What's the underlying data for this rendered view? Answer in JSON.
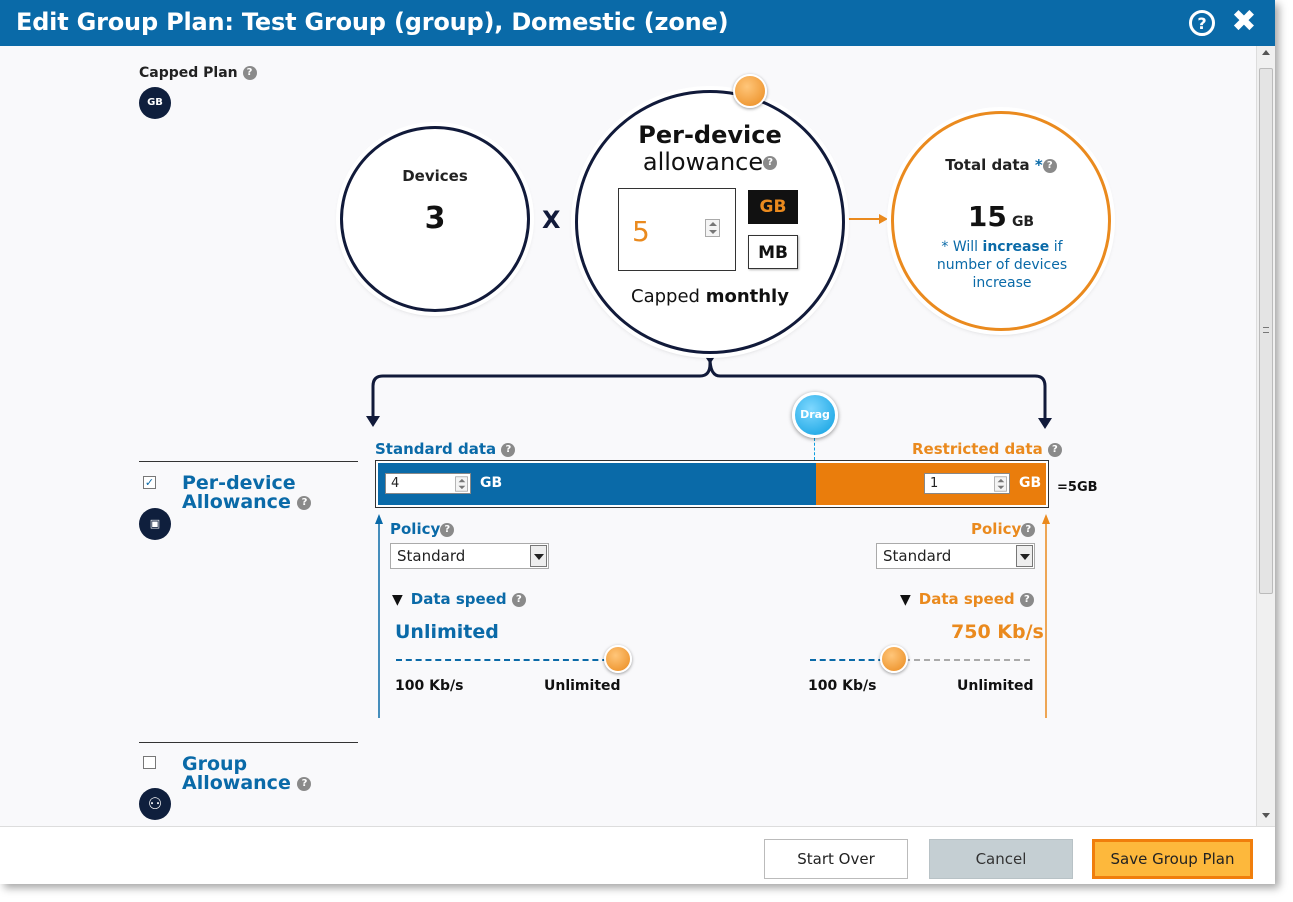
{
  "dialog": {
    "title": "Edit Group Plan: Test Group (group), Domestic (zone)",
    "help_icon": "?",
    "close_icon": "✖"
  },
  "plan_type": {
    "label": "Capped Plan",
    "icon_text": "GB"
  },
  "devices": {
    "label": "Devices",
    "value": "3",
    "operator": "X"
  },
  "allowance": {
    "title_bold": "Per-device",
    "title_light": "allowance",
    "value": "5",
    "unit_gb": "GB",
    "unit_mb": "MB",
    "selected_unit": "GB",
    "footer_prefix": "Capped ",
    "footer_bold": "monthly"
  },
  "total": {
    "label": "Total data",
    "asterisk": "*",
    "value": "15",
    "unit": "GB",
    "note_prefix": "* Will ",
    "note_bold": "increase",
    "note_suffix": " if number of devices increase"
  },
  "split": {
    "standard_label": "Standard data",
    "restricted_label": "Restricted data",
    "drag_label": "Drag",
    "standard_value": "4",
    "restricted_value": "1",
    "unit": "GB",
    "total_label": "=5GB",
    "standard_fraction": 0.8
  },
  "sections": {
    "per_device": {
      "title_line1": "Per-device",
      "title_line2": "Allowance",
      "checked": true,
      "check_mark": "✓",
      "icon_text": "▣"
    },
    "group": {
      "title_line1": "Group",
      "title_line2": "Allowance",
      "checked": false,
      "icon_text": "⚇"
    }
  },
  "policy": {
    "label": "Policy",
    "standard_selected": "Standard",
    "restricted_selected": "Standard"
  },
  "data_speed": {
    "label": "Data speed",
    "collapse_icon": "▼",
    "standard_value": "Unlimited",
    "restricted_value": "750 Kb/s",
    "min_label": "100 Kb/s",
    "max_label": "Unlimited",
    "standard_level": 1.0,
    "restricted_level": 0.38
  },
  "footer": {
    "start_over": "Start Over",
    "cancel": "Cancel",
    "save": "Save Group Plan"
  },
  "colors": {
    "primary_blue": "#0a6aa8",
    "accent_orange": "#ea8a1e",
    "navy": "#111a3a"
  }
}
